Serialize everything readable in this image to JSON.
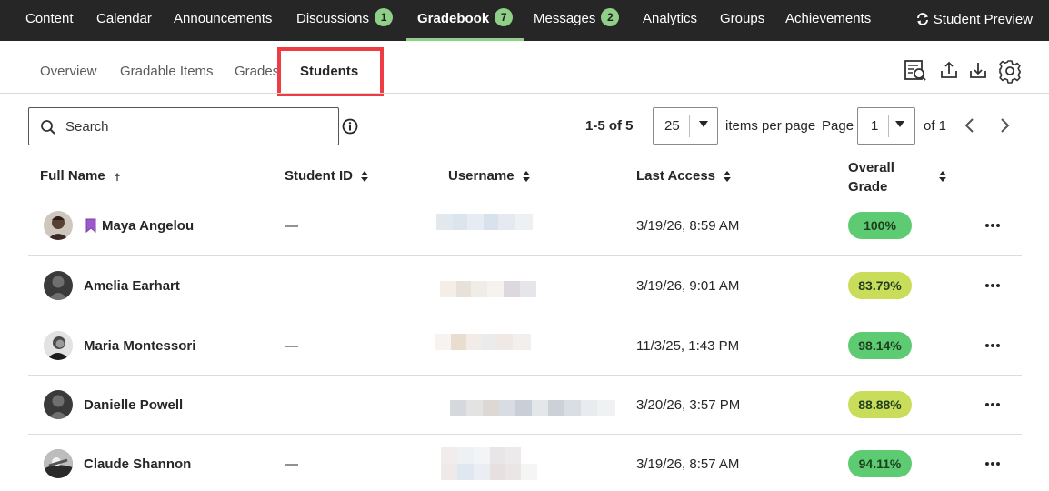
{
  "topnav": {
    "items": [
      {
        "label": "Content"
      },
      {
        "label": "Calendar"
      },
      {
        "label": "Announcements"
      },
      {
        "label": "Discussions",
        "badge": "1"
      },
      {
        "label": "Gradebook",
        "badge": "7"
      },
      {
        "label": "Messages",
        "badge": "2"
      },
      {
        "label": "Analytics"
      },
      {
        "label": "Groups"
      },
      {
        "label": "Achievements"
      }
    ],
    "active": "Gradebook",
    "student_preview": "Student Preview"
  },
  "subnav": {
    "tabs": [
      {
        "label": "Overview"
      },
      {
        "label": "Gradable Items"
      },
      {
        "label": "Grades"
      },
      {
        "label": "Students"
      }
    ],
    "active": "Students"
  },
  "toolbar": {
    "icons": [
      "grade-search-icon",
      "upload-icon",
      "download-icon",
      "settings-gear-icon"
    ]
  },
  "search": {
    "placeholder": "Search",
    "value": ""
  },
  "paging": {
    "range": "1-5 of 5",
    "per_page": "25",
    "per_page_label": "items per page",
    "page_label": "Page",
    "page": "1",
    "of": "of 1"
  },
  "table": {
    "headers": {
      "name": "Full Name",
      "student_id": "Student ID",
      "username": "Username",
      "last_access": "Last Access",
      "grade_line1": "Overall",
      "grade_line2": "Grade"
    },
    "rows": [
      {
        "name": "Maya Angelou",
        "student_id": "—",
        "last_access": "3/19/26, 8:59 AM",
        "grade": "100%",
        "grade_color": "#5dcb72",
        "bookmarked": true
      },
      {
        "name": "Amelia Earhart",
        "student_id": "",
        "last_access": "3/19/26, 9:01 AM",
        "grade": "83.79%",
        "grade_color": "#c9dd5a",
        "bookmarked": false
      },
      {
        "name": "Maria Montessori",
        "student_id": "—",
        "last_access": "11/3/25, 1:43 PM",
        "grade": "98.14%",
        "grade_color": "#5dcb72",
        "bookmarked": false
      },
      {
        "name": "Danielle Powell",
        "student_id": "",
        "last_access": "3/20/26, 3:57 PM",
        "grade": "88.88%",
        "grade_color": "#c9dd5a",
        "bookmarked": false
      },
      {
        "name": "Claude Shannon",
        "student_id": "—",
        "last_access": "3/19/26, 8:57 AM",
        "grade": "94.11%",
        "grade_color": "#5dcb72",
        "bookmarked": false
      }
    ]
  },
  "colors": {
    "nav_bg": "#262626",
    "accent_green": "#8fcf88",
    "highlight_red": "#ef3b43",
    "bookmark_purple": "#9b59c9"
  }
}
